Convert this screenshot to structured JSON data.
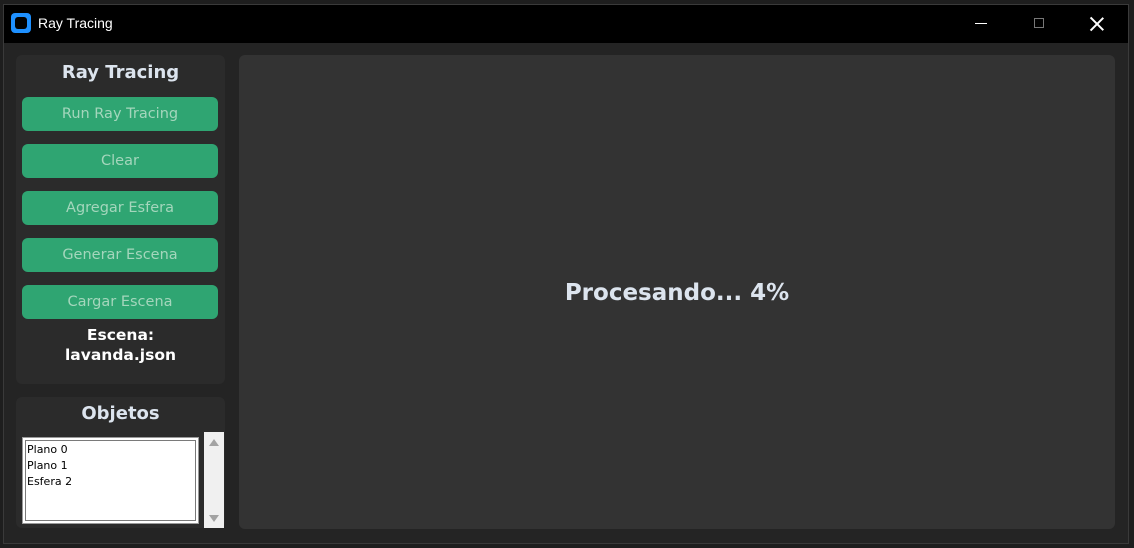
{
  "window": {
    "title": "Ray Tracing",
    "icon": "app-icon"
  },
  "sidebar": {
    "heading": "Ray Tracing",
    "buttons": [
      {
        "label": "Run Ray Tracing"
      },
      {
        "label": "Clear"
      },
      {
        "label": "Agregar Esfera"
      },
      {
        "label": "Generar Escena"
      },
      {
        "label": "Cargar Escena"
      }
    ],
    "scene_caption": "Escena:",
    "scene_file": "lavanda.json"
  },
  "objects_panel": {
    "heading": "Objetos",
    "items": [
      "Plano 0",
      "Plano 1",
      "Esfera 2"
    ]
  },
  "canvas": {
    "status": "Procesando... 4%"
  },
  "colors": {
    "button_bg": "#2fa572",
    "panel_bg": "#2b2b2b",
    "canvas_bg": "#333333",
    "titlebar_bg": "#000000",
    "accent_icon": "#1e90ff"
  }
}
